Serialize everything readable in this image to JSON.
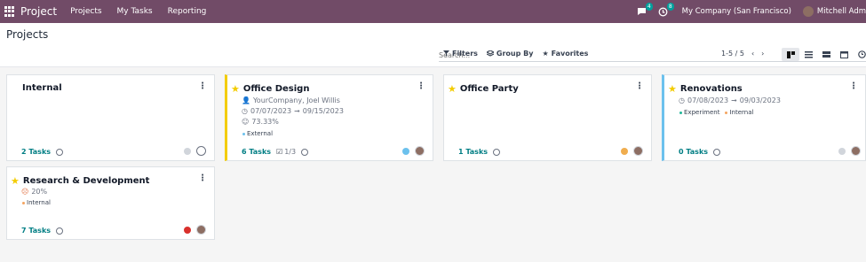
{
  "navbar": {
    "brand": "Project",
    "menu": [
      "Projects",
      "My Tasks",
      "Reporting"
    ],
    "chat_count": "4",
    "activity_count": "8",
    "company": "My Company (San Francisco)",
    "user": "Mitchell Adm"
  },
  "control": {
    "title": "Projects",
    "search_placeholder": "Search...",
    "filters_label": "Filters",
    "groupby_label": "Group By",
    "favorites_label": "Favorites",
    "pager": "1-5 / 5"
  },
  "colors": {
    "navbar": "#714b67",
    "accent": "#017e84",
    "star": "#f3cc00"
  },
  "cards": [
    {
      "name": "Internal",
      "tasks": "2 Tasks"
    },
    {
      "name": "Office Design",
      "customer": "YourCompany, Joel Willis",
      "date_start": "07/07/2023",
      "date_end": "09/15/2023",
      "progress": "73.33%",
      "tags": [
        "External"
      ],
      "tasks": "6 Tasks",
      "subtasks": "1/3"
    },
    {
      "name": "Office Party",
      "tasks": "1 Tasks"
    },
    {
      "name": "Renovations",
      "date_start": "07/08/2023",
      "date_end": "09/03/2023",
      "tags": [
        "Experiment",
        "Internal"
      ],
      "tasks": "0 Tasks"
    },
    {
      "name": "Research & Development",
      "progress": "20%",
      "tags": [
        "Internal"
      ],
      "tasks": "7 Tasks"
    }
  ]
}
